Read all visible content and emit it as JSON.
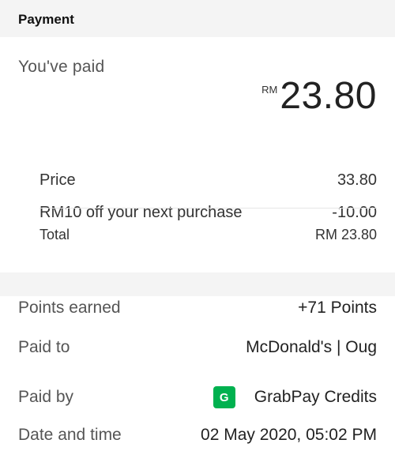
{
  "header": {
    "title": "Payment"
  },
  "summary": {
    "paid_label": "You've paid",
    "currency": "RM",
    "amount": "23.80",
    "lines": [
      {
        "label": "Price",
        "value": "33.80"
      },
      {
        "label": "RM10 off your next purchase",
        "value": "-10.00"
      }
    ],
    "total": {
      "label": "Total",
      "value": "RM 23.80"
    }
  },
  "details": {
    "points": {
      "label": "Points earned",
      "value": "+71 Points"
    },
    "paid_to": {
      "label": "Paid to",
      "value": "McDonald's | Oug"
    },
    "paid_by": {
      "label": "Paid by",
      "value": "GrabPay Credits",
      "icon_letter": "G",
      "icon": "grabpay-icon",
      "icon_color": "#00b14f"
    },
    "datetime": {
      "label": "Date and time",
      "value": "02 May 2020, 05:02 PM"
    }
  }
}
